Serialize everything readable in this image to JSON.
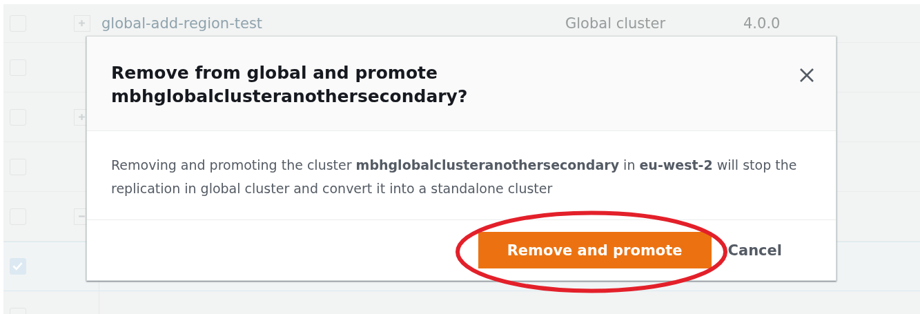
{
  "table": {
    "rows": [
      {
        "kind": "collapsed",
        "checked": false,
        "name": "global-add-region-test",
        "type": "Global cluster",
        "version": "4.0.0"
      },
      {
        "kind": "plain",
        "checked": false
      },
      {
        "kind": "collapsed",
        "checked": false
      },
      {
        "kind": "plain",
        "checked": false
      },
      {
        "kind": "expanded",
        "checked": false
      },
      {
        "kind": "child",
        "checked": true
      },
      {
        "kind": "child",
        "checked": false
      }
    ]
  },
  "modal": {
    "title": "Remove from global and promote mbhglobalclusteranothersecondary?",
    "message": "Removing and promoting the cluster **mbhglobalclusteranothersecondary** in **eu-west-2** will stop the replication in global cluster and convert it into a standalone cluster",
    "buttons": [
      {
        "label": "Remove and promote",
        "kind": "primary",
        "circled": true
      },
      {
        "label": "Cancel",
        "kind": "link",
        "circled": false
      }
    ]
  }
}
